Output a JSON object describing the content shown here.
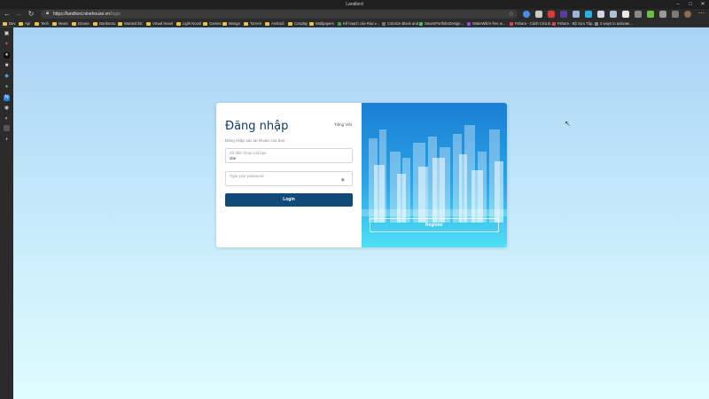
{
  "window": {
    "title": "Landlord"
  },
  "browser": {
    "url_host": "https://landlord.ninehouse.vn",
    "url_path": "/login"
  },
  "bookmarks": [
    {
      "label": "Dev",
      "kind": "folder"
    },
    {
      "label": "Api",
      "kind": "folder"
    },
    {
      "label": "Tech",
      "kind": "folder"
    },
    {
      "label": "Music",
      "kind": "folder"
    },
    {
      "label": "Drama",
      "kind": "folder"
    },
    {
      "label": "Danbooru",
      "kind": "folder"
    },
    {
      "label": "Wanted list",
      "kind": "folder"
    },
    {
      "label": "Visual Novel",
      "kind": "folder"
    },
    {
      "label": "Light Novel",
      "kind": "folder"
    },
    {
      "label": "Games",
      "kind": "folder"
    },
    {
      "label": "Manga",
      "kind": "folder"
    },
    {
      "label": "Torrent",
      "kind": "folder"
    },
    {
      "label": "Android",
      "kind": "folder"
    },
    {
      "label": "Cosplay",
      "kind": "folder"
    },
    {
      "label": "Wallpapers",
      "kind": "folder"
    },
    {
      "label": "Kế hoạch của Rùa v...",
      "kind": "site",
      "color": "#2fa84f"
    },
    {
      "label": "Colorize Black and...",
      "kind": "site",
      "color": "#777777"
    },
    {
      "label": "SteamPortfolioDesign...",
      "kind": "site",
      "color": "#3cc36b"
    },
    {
      "label": "WakeWiki's free w...",
      "kind": "site",
      "color": "#9a4bd8"
    },
    {
      "label": "Fshare - Cánh Cửa Đ...",
      "kind": "site",
      "color": "#e04848"
    },
    {
      "label": "Fshare - Bộ Sưu Tập...",
      "kind": "site",
      "color": "#e04848"
    },
    {
      "label": "2 ways to activate...",
      "kind": "site",
      "color": "#888888"
    }
  ],
  "login": {
    "title": "Đăng nhập",
    "language": "Tiếng Việt",
    "subtitle": "Đăng nhập vào tài khoản của bạn",
    "username": {
      "placeholder": "Số điện thoại của bạn",
      "value": "vbe"
    },
    "password": {
      "placeholder": "Type your password"
    },
    "button_label": "Login"
  },
  "register": {
    "button_label": "Register"
  },
  "colors": {
    "primary": "#0f4a78",
    "title": "#0f3b66",
    "panel_top": "#1a7fd3",
    "panel_bottom": "#4fe1f5"
  }
}
